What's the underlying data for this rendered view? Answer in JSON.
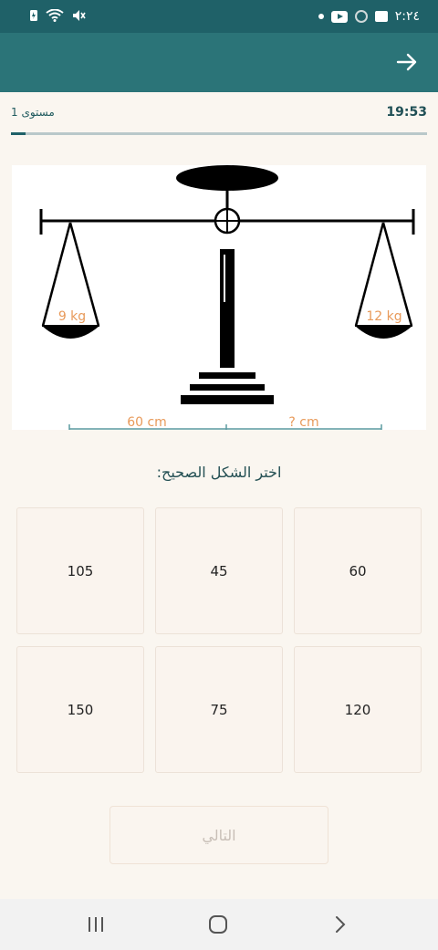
{
  "status_bar": {
    "time": "٢:٢٤",
    "left_icons": [
      "battery-saver-icon",
      "wifi-icon",
      "mute-icon"
    ],
    "right_icons": [
      "dot-icon",
      "youtube-icon",
      "ring-icon",
      "image-icon"
    ]
  },
  "app_bar": {
    "back_icon": "arrow-right-icon"
  },
  "level": {
    "label": "مستوى 1",
    "timer": "19:53",
    "progress": 0.035
  },
  "scale": {
    "left_weight": "9 kg",
    "right_weight": "12 kg",
    "left_distance": "60 cm",
    "right_distance": "? cm"
  },
  "question": "اختر الشكل الصحيح:",
  "options": [
    "60",
    "45",
    "105",
    "120",
    "75",
    "150"
  ],
  "next_button": "التالي",
  "colors": {
    "header": "#2b7478",
    "status": "#1f6168",
    "accent": "#1f5a5e",
    "label": "#e89a5a"
  },
  "nav": [
    "recents-icon",
    "home-icon",
    "back-icon"
  ]
}
